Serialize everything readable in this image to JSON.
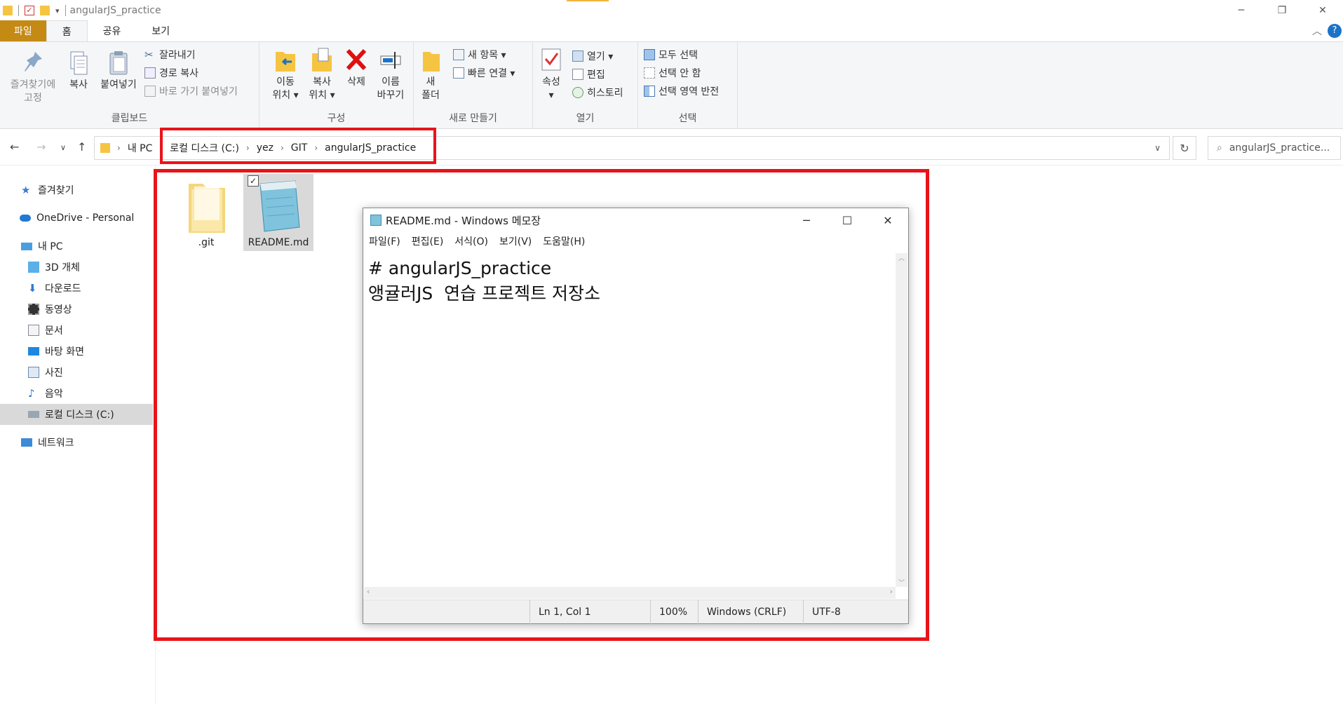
{
  "window": {
    "title": "angularJS_practice",
    "controls": [
      "─",
      "❐",
      "✕"
    ]
  },
  "ribbon_tabs": [
    "파일",
    "홈",
    "공유",
    "보기"
  ],
  "ribbon": {
    "clipboard": {
      "label": "클립보드",
      "pin": [
        "즐겨찾기에",
        "고정"
      ],
      "copy": "복사",
      "paste": "붙여넣기",
      "cut": "잘라내기",
      "copy_path": "경로 복사",
      "paste_shortcut": "바로 가기 붙여넣기"
    },
    "organize": {
      "label": "구성",
      "move_to": [
        "이동",
        "위치 ▾"
      ],
      "copy_to": [
        "복사",
        "위치 ▾"
      ],
      "delete": "삭제",
      "rename": [
        "이름",
        "바꾸기"
      ]
    },
    "new": {
      "label": "새로 만들기",
      "new_folder": [
        "새",
        "폴더"
      ],
      "new_item": "새 항목 ▾",
      "easy_access": "빠른 연결 ▾"
    },
    "open": {
      "label": "열기",
      "properties": [
        "속성",
        "▾"
      ],
      "open": "열기 ▾",
      "edit": "편집",
      "history": "히스토리"
    },
    "select": {
      "label": "선택",
      "select_all": "모두 선택",
      "select_none": "선택 안 함",
      "invert": "선택 영역 반전"
    }
  },
  "address": {
    "crumbs": [
      "내 PC",
      "로컬 디스크 (C:)",
      "yez",
      "GIT",
      "angularJS_practice"
    ],
    "search_placeholder": "angularJS_practice..."
  },
  "nav": {
    "quick_access": "즐겨찾기",
    "onedrive": "OneDrive - Personal",
    "this_pc": "내 PC",
    "objects3d": "3D 개체",
    "downloads": "다운로드",
    "videos": "동영상",
    "documents": "문서",
    "desktop": "바탕 화면",
    "pictures": "사진",
    "music": "음악",
    "local_disk": "로컬 디스크 (C:)",
    "network": "네트워크"
  },
  "files": [
    {
      "name": ".git"
    },
    {
      "name": "README.md"
    }
  ],
  "notepad": {
    "title": "README.md - Windows 메모장",
    "menu": [
      "파일(F)",
      "편집(E)",
      "서식(O)",
      "보기(V)",
      "도움말(H)"
    ],
    "lines": [
      "# angularJS_practice",
      "앵귤러JS  연습 프로젝트 저장소"
    ],
    "status": {
      "position": "Ln 1, Col 1",
      "zoom": "100%",
      "line_ending": "Windows (CRLF)",
      "encoding": "UTF-8"
    }
  },
  "colors": {
    "file_tab": "#c58a13",
    "highlight_red": "#e8141a",
    "folder_yellow": "#f5c542"
  }
}
